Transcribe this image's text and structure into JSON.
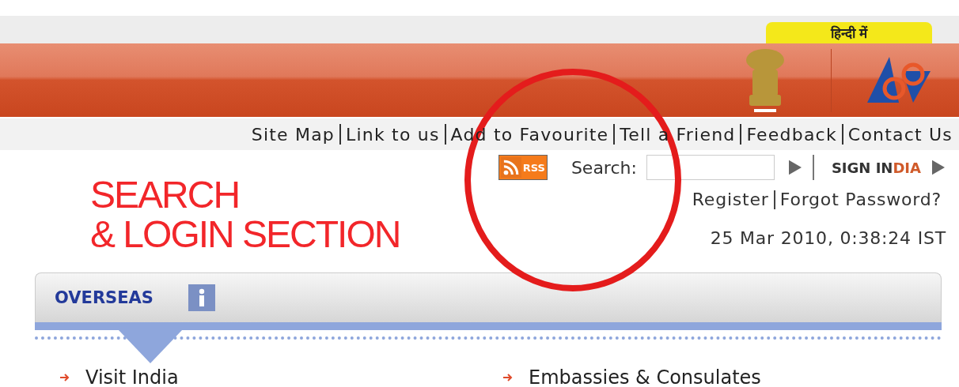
{
  "language_button": {
    "label": "हिन्दी में"
  },
  "nav_links": [
    "Site Map",
    "Link to us",
    "Add to Favourite",
    "Tell a Friend",
    "Feedback",
    "Contact Us"
  ],
  "rss": {
    "label": "RSS"
  },
  "search": {
    "label": "Search:"
  },
  "sign_in": {
    "label": "SIGN IN",
    "label_accent": "DIA"
  },
  "account_links": [
    "Register",
    "Forgot Password?"
  ],
  "datetime": "25 Mar 2010, 0:38:24 IST",
  "annotation": {
    "lines": [
      "SEARCH",
      "& LOGIN SECTION"
    ]
  },
  "tabs": [
    {
      "label": "OVERSEAS",
      "selected": true
    }
  ],
  "links": [
    "Visit India",
    "Embassies & Consulates"
  ]
}
